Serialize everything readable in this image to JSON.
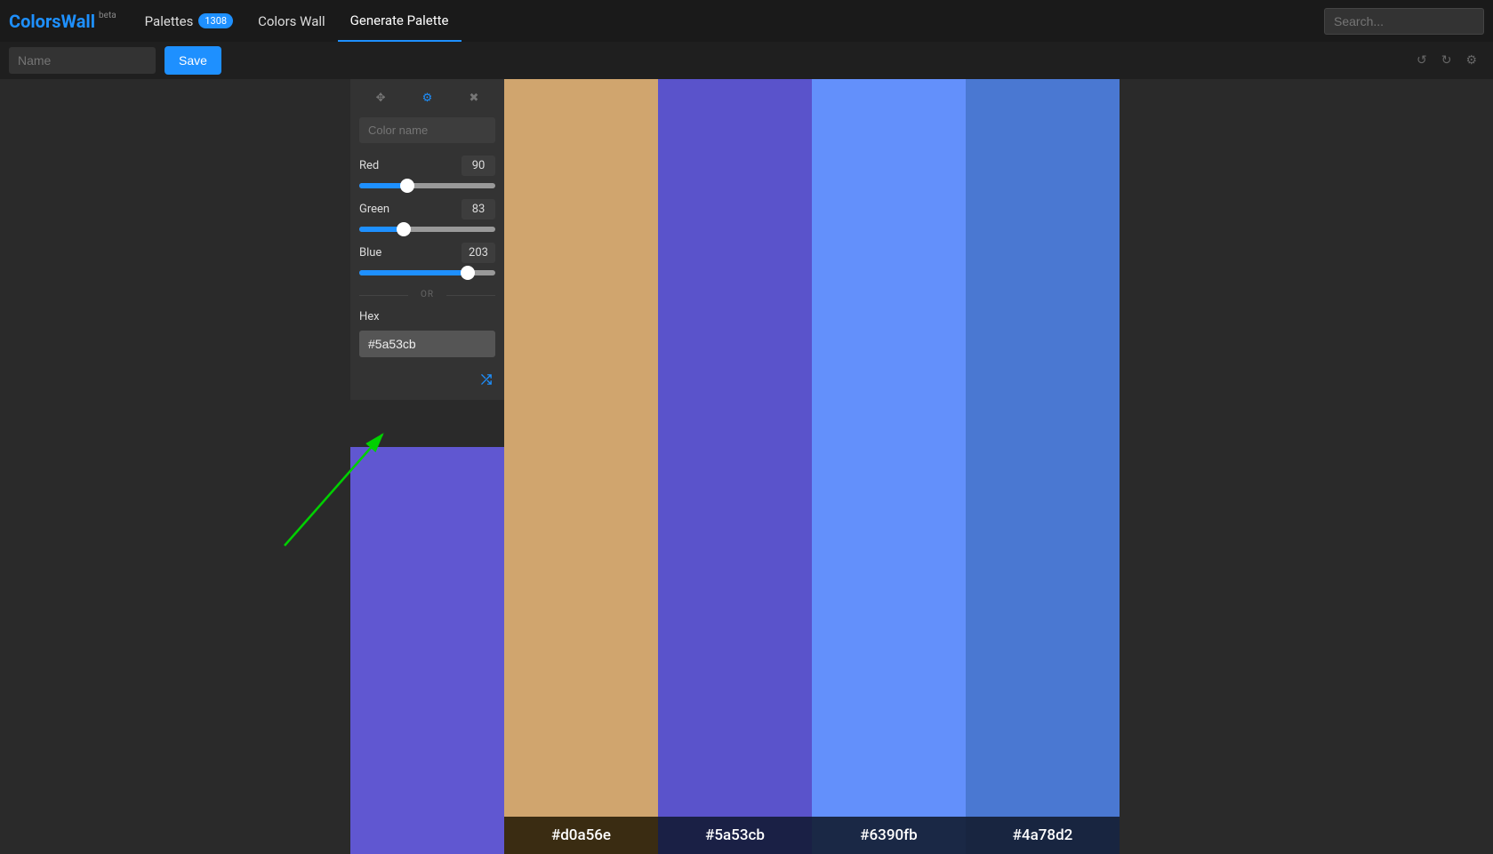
{
  "nav": {
    "brand": "ColorsWall",
    "beta": "beta",
    "palettes": "Palettes",
    "palettes_count": "1308",
    "colors_wall": "Colors Wall",
    "generate": "Generate Palette",
    "search_placeholder": "Search..."
  },
  "toolbar": {
    "name_placeholder": "Name",
    "save": "Save"
  },
  "panel": {
    "colorname_placeholder": "Color name",
    "red_label": "Red",
    "red_val": "90",
    "red_pct": 35.3,
    "green_label": "Green",
    "green_val": "83",
    "green_pct": 32.5,
    "blue_label": "Blue",
    "blue_val": "203",
    "blue_pct": 79.6,
    "or": "OR",
    "hex_label": "Hex",
    "hex_val": "#5a53cb"
  },
  "colors": [
    {
      "hex": "#6057d1",
      "label": ""
    },
    {
      "hex": "#d0a56e",
      "label": "#d0a56e",
      "footer_bg": "#3a2c12"
    },
    {
      "hex": "#5a53cb",
      "label": "#5a53cb",
      "footer_bg": "#1a2045"
    },
    {
      "hex": "#6390fb",
      "label": "#6390fb",
      "footer_bg": "#1a2845"
    },
    {
      "hex": "#4a78d2",
      "label": "#4a78d2",
      "footer_bg": "#182540"
    }
  ]
}
